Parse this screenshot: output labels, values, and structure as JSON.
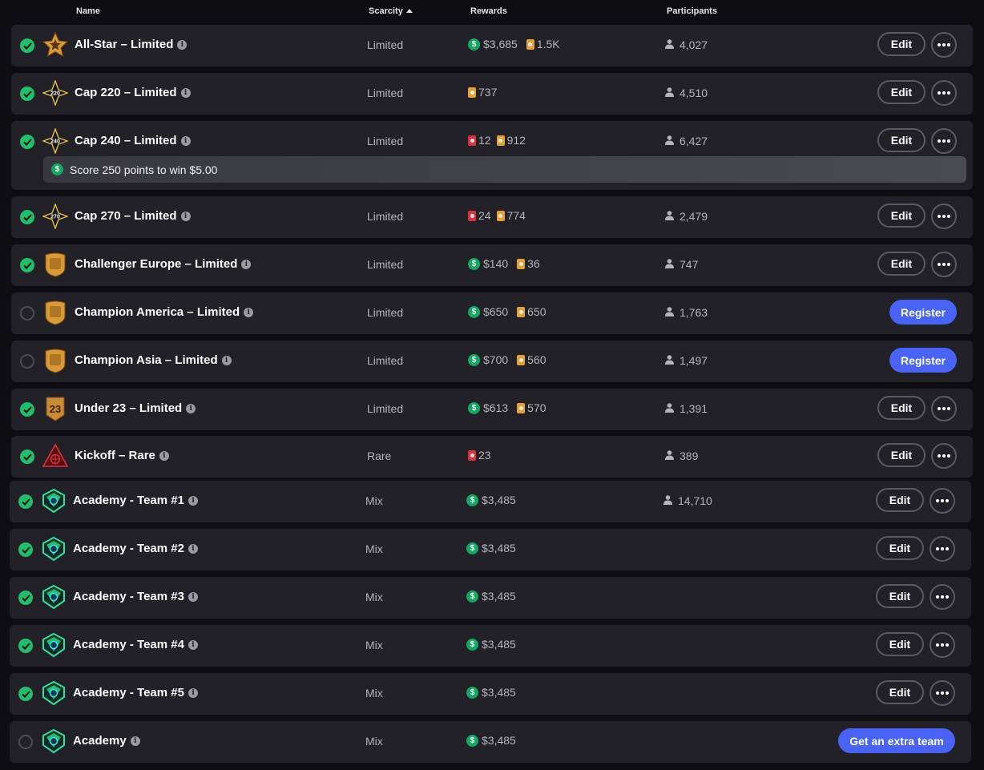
{
  "header": {
    "name": "Name",
    "scarcity": "Scarcity",
    "rewards": "Rewards",
    "participants": "Participants"
  },
  "colors": {
    "background": "#0e0e12",
    "row": "#212127",
    "check": "#1fbf6b",
    "primary": "#4863f5",
    "dollar": "#14a862",
    "card_limited": "#e6a133",
    "card_rare": "#d8343c"
  },
  "buttons": {
    "edit": "Edit",
    "register": "Register",
    "extra": "Get an extra team"
  },
  "rows": [
    {
      "name": "All-Star – Limited",
      "icon": "star-badge-icon",
      "scarcity": "Limited",
      "cash": "$3,685",
      "limited": "1.5K",
      "participants": "4,027",
      "checked": true,
      "action": "edit"
    },
    {
      "name": "Cap 220 – Limited",
      "icon": "cap-220-badge-icon",
      "badge_text": "220",
      "scarcity": "Limited",
      "limited": "737",
      "participants": "4,510",
      "checked": true,
      "action": "edit"
    },
    {
      "name": "Cap 240 – Limited",
      "icon": "cap-240-badge-icon",
      "badge_text": "240",
      "scarcity": "Limited",
      "rare": "12",
      "limited": "912",
      "participants": "6,427",
      "checked": true,
      "action": "edit",
      "promo": "Score 250 points to win $5.00"
    },
    {
      "name": "Cap 270 – Limited",
      "icon": "cap-270-badge-icon",
      "badge_text": "270",
      "scarcity": "Limited",
      "rare": "24",
      "limited": "774",
      "participants": "2,479",
      "checked": true,
      "action": "edit"
    },
    {
      "name": "Challenger Europe – Limited",
      "icon": "europe-badge-icon",
      "scarcity": "Limited",
      "cash": "$140",
      "limited": "36",
      "participants": "747",
      "checked": true,
      "action": "edit"
    },
    {
      "name": "Champion America – Limited",
      "icon": "america-badge-icon",
      "scarcity": "Limited",
      "cash": "$650",
      "limited": "650",
      "participants": "1,763",
      "checked": false,
      "action": "register"
    },
    {
      "name": "Champion Asia – Limited",
      "icon": "asia-badge-icon",
      "scarcity": "Limited",
      "cash": "$700",
      "limited": "560",
      "participants": "1,497",
      "checked": false,
      "action": "register"
    },
    {
      "name": "Under 23 – Limited",
      "icon": "under-23-badge-icon",
      "badge_text": "23",
      "scarcity": "Limited",
      "cash": "$613",
      "limited": "570",
      "participants": "1,391",
      "checked": true,
      "action": "edit"
    },
    {
      "name": "Kickoff – Rare",
      "icon": "kickoff-badge-icon",
      "scarcity": "Rare",
      "rare": "23",
      "participants": "389",
      "checked": true,
      "action": "edit"
    },
    {
      "name": "Academy - Team #1",
      "icon": "academy-badge-icon",
      "scarcity": "Mix",
      "cash": "$3,485",
      "participants": "14,710",
      "checked": true,
      "action": "edit"
    },
    {
      "name": "Academy - Team #2",
      "icon": "academy-badge-icon",
      "scarcity": "Mix",
      "cash": "$3,485",
      "checked": true,
      "action": "edit"
    },
    {
      "name": "Academy - Team #3",
      "icon": "academy-badge-icon",
      "scarcity": "Mix",
      "cash": "$3,485",
      "checked": true,
      "action": "edit"
    },
    {
      "name": "Academy - Team #4",
      "icon": "academy-badge-icon",
      "scarcity": "Mix",
      "cash": "$3,485",
      "checked": true,
      "action": "edit"
    },
    {
      "name": "Academy - Team #5",
      "icon": "academy-badge-icon",
      "scarcity": "Mix",
      "cash": "$3,485",
      "checked": true,
      "action": "edit"
    },
    {
      "name": "Academy",
      "icon": "academy-badge-icon",
      "scarcity": "Mix",
      "cash": "$3,485",
      "checked": false,
      "action": "extra"
    }
  ]
}
